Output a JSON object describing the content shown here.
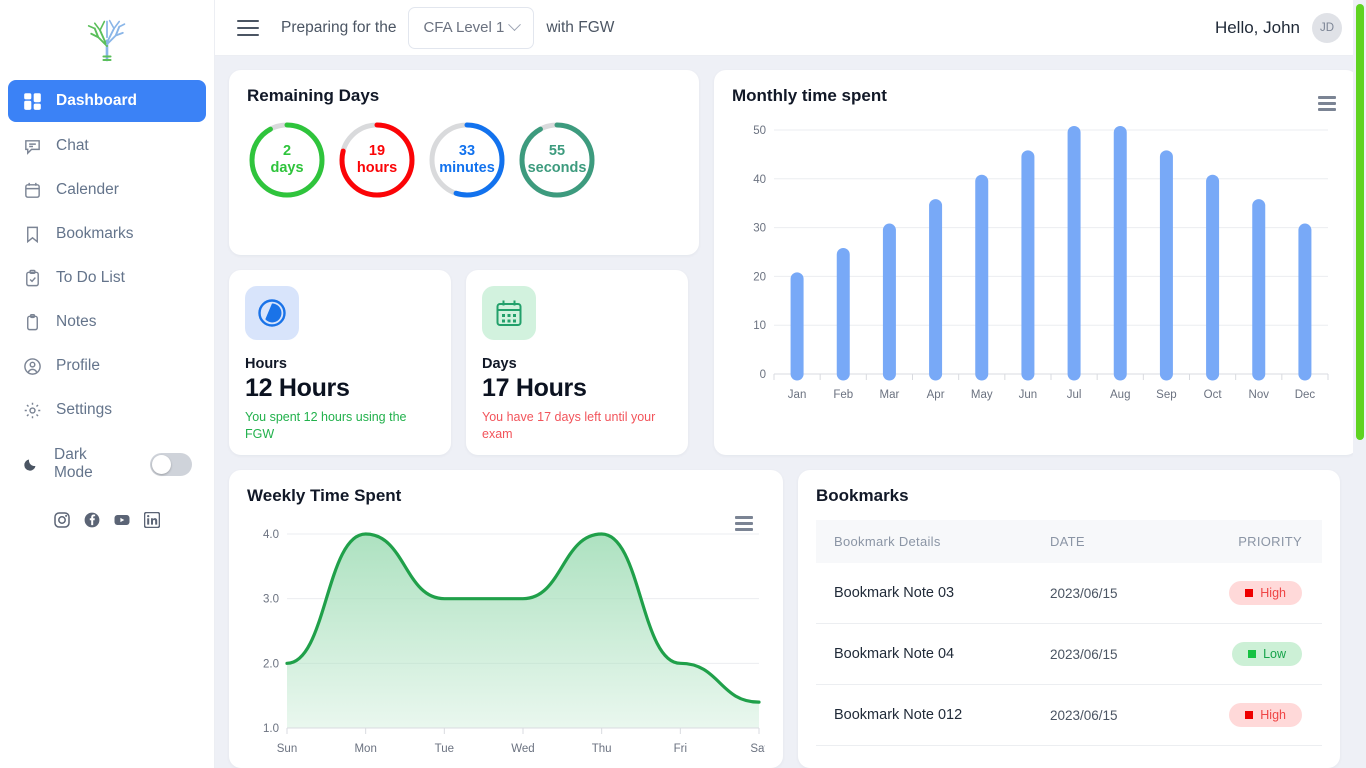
{
  "sidebar": {
    "logo_name": "tree-logo",
    "items": [
      {
        "label": "Dashboard",
        "icon": "dashboard-grid-icon",
        "active": true
      },
      {
        "label": "Chat",
        "icon": "chat-bubble-icon",
        "active": false
      },
      {
        "label": "Calender",
        "icon": "calendar-icon",
        "active": false
      },
      {
        "label": "Bookmarks",
        "icon": "bookmark-icon",
        "active": false
      },
      {
        "label": "To Do List",
        "icon": "clipboard-check-icon",
        "active": false
      },
      {
        "label": "Notes",
        "icon": "clipboard-icon",
        "active": false
      },
      {
        "label": "Profile",
        "icon": "user-circle-icon",
        "active": false
      },
      {
        "label": "Settings",
        "icon": "gear-icon",
        "active": false
      }
    ],
    "dark_mode_label": "Dark Mode",
    "dark_mode_on": false,
    "socials": [
      "instagram-icon",
      "facebook-icon",
      "youtube-icon",
      "linkedin-icon"
    ]
  },
  "topbar": {
    "menu_icon": "hamburger-menu-icon",
    "prefix_text": "Preparing for the",
    "exam_select_value": "CFA Level 1",
    "suffix_text": "with FGW",
    "greeting": "Hello, John",
    "avatar_initials": "JD"
  },
  "remaining": {
    "title": "Remaining Days",
    "rings": [
      {
        "value": "2",
        "unit": "days",
        "color": "#2fc43c",
        "pct": 92
      },
      {
        "value": "19",
        "unit": "hours",
        "color": "#fb0407",
        "pct": 79
      },
      {
        "value": "33",
        "unit": "minutes",
        "color": "#1272ee",
        "pct": 55
      },
      {
        "value": "55",
        "unit": "seconds",
        "color": "#3d9b7e",
        "pct": 92
      }
    ],
    "track_color": "#d9dadc"
  },
  "stats": [
    {
      "icon": "clock-pie-icon",
      "icon_bg": "#d8e4fb",
      "icon_color": "#1a73e8",
      "label": "Hours",
      "value": "12 Hours",
      "desc": "You spent 12 hours using the FGW",
      "desc_color": "#22b14c"
    },
    {
      "icon": "calendar-days-icon",
      "icon_bg": "#d2f2de",
      "icon_color": "#22a06b",
      "label": "Days",
      "value": "17 Hours",
      "desc": "You have 17 days left until your exam",
      "desc_color": "#f2545b"
    }
  ],
  "chart_data": [
    {
      "type": "bar",
      "title": "Monthly time spent",
      "categories": [
        "Jan",
        "Feb",
        "Mar",
        "Apr",
        "May",
        "Jun",
        "Jul",
        "Aug",
        "Sep",
        "Oct",
        "Nov",
        "Dec"
      ],
      "values": [
        19.5,
        24.5,
        29.5,
        34.5,
        39.5,
        44.5,
        49.5,
        49.5,
        44.5,
        39.5,
        34.5,
        29.5
      ],
      "yticks": [
        0,
        10,
        20,
        30,
        40,
        50
      ],
      "ylim": [
        0,
        50
      ],
      "xlabel": "",
      "ylabel": "",
      "grid": true,
      "legend": false,
      "series_color": "#78a9f7",
      "menu_icon": "chart-export-menu-icon"
    },
    {
      "type": "area",
      "title": "Weekly Time Spent",
      "categories": [
        "Sun",
        "Mon",
        "Tue",
        "Wed",
        "Thu",
        "Fri",
        "Sat"
      ],
      "values": [
        2.0,
        4.0,
        3.0,
        3.0,
        4.0,
        2.0,
        1.4
      ],
      "yticks": [
        1.0,
        2.0,
        3.0,
        4.0
      ],
      "ylim": [
        1.0,
        4.0
      ],
      "xlabel": "",
      "ylabel": "",
      "grid": true,
      "legend": false,
      "line_color": "#20a04a",
      "fill_color": "#a9e0bd",
      "menu_icon": "chart-export-menu-icon"
    }
  ],
  "bookmarks": {
    "title": "Bookmarks",
    "columns": [
      "Bookmark Details",
      "DATE",
      "PRIORITY"
    ],
    "rows": [
      {
        "name": "Bookmark Note 03",
        "date": "2023/06/15",
        "priority": "High",
        "priority_level": "high"
      },
      {
        "name": "Bookmark Note 04",
        "date": "2023/06/15",
        "priority": "Low",
        "priority_level": "low"
      },
      {
        "name": "Bookmark Note 012",
        "date": "2023/06/15",
        "priority": "High",
        "priority_level": "high"
      }
    ]
  },
  "scrollbar": {
    "color": "#5fd320"
  }
}
